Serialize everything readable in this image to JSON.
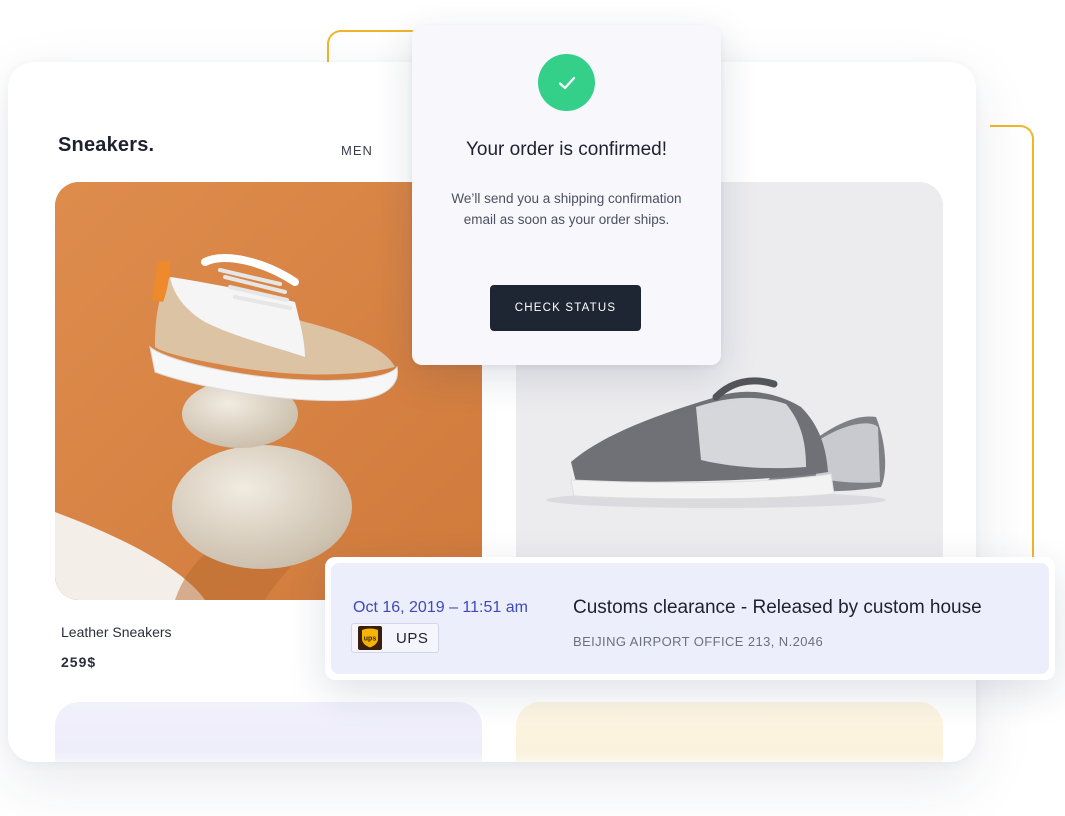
{
  "shop": {
    "brand": "Sneakers.",
    "nav": [
      "MEN"
    ],
    "products": [
      {
        "name": "Leather Sneakers",
        "price": "259$"
      }
    ]
  },
  "confirmation": {
    "title": "Your order is confirmed!",
    "message": "We’ll send you a shipping confirmation email as soon as your order ships.",
    "button_label": "CHECK STATUS",
    "icon": "checkmark-icon",
    "accent_color": "#34d08a"
  },
  "tracking": {
    "datetime": "Oct 16, 2019 – 11:51 am",
    "carrier": "UPS",
    "carrier_logo_text": "ups",
    "status": "Customs clearance - Released by custom house",
    "location": "BEIJING AIRPORT OFFICE 213, N.2046"
  },
  "colors": {
    "accent_orange": "#f0b52a",
    "button_dark": "#1d2632",
    "tracking_bg": "#eceefc",
    "date_blue": "#3d4bb5"
  }
}
